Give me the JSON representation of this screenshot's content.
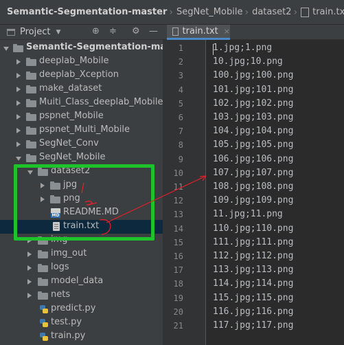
{
  "breadcrumb": {
    "root": "Semantic-Segmentation-master",
    "items": [
      "SegNet_Mobile",
      "dataset2"
    ],
    "file": "train.txt"
  },
  "project_panel": {
    "title": "Project",
    "toolbar_icons": [
      "target-icon",
      "collapse-icon",
      "gear-icon",
      "hide-icon"
    ]
  },
  "tabs": [
    {
      "label": "train.txt",
      "active": true,
      "close": "×"
    }
  ],
  "tree": [
    {
      "label": "Semantic-Segmentation-master",
      "type": "root",
      "expanded": true
    },
    {
      "label": "deeplab_Mobile",
      "type": "folder",
      "expanded": false
    },
    {
      "label": "deeplab_Xception",
      "type": "folder",
      "expanded": false
    },
    {
      "label": "make_dataset",
      "type": "folder",
      "expanded": false
    },
    {
      "label": "Muiti_Class_deeplab_Mobile",
      "type": "folder",
      "expanded": false
    },
    {
      "label": "pspnet_Mobile",
      "type": "folder",
      "expanded": false
    },
    {
      "label": "pspnet_Multi_Mobile",
      "type": "folder",
      "expanded": false
    },
    {
      "label": "SegNet_Conv",
      "type": "folder",
      "expanded": false
    },
    {
      "label": "SegNet_Mobile",
      "type": "folder",
      "expanded": true
    },
    {
      "label": "dataset2",
      "type": "folder",
      "expanded": true
    },
    {
      "label": "jpg",
      "type": "folder",
      "expanded": false
    },
    {
      "label": "png",
      "type": "folder",
      "expanded": false
    },
    {
      "label": "README.MD",
      "type": "md"
    },
    {
      "label": "train.txt",
      "type": "txt",
      "selected": true
    },
    {
      "label": "img",
      "type": "folder",
      "expanded": false
    },
    {
      "label": "img_out",
      "type": "folder",
      "expanded": false
    },
    {
      "label": "logs",
      "type": "folder",
      "expanded": false
    },
    {
      "label": "model_data",
      "type": "folder",
      "expanded": false
    },
    {
      "label": "nets",
      "type": "folder",
      "expanded": false
    },
    {
      "label": "predict.py",
      "type": "py"
    },
    {
      "label": "test.py",
      "type": "py"
    },
    {
      "label": "train.py",
      "type": "py"
    }
  ],
  "editor": {
    "line_numbers": [
      "1",
      "2",
      "3",
      "4",
      "5",
      "6",
      "7",
      "8",
      "9",
      "10",
      "11",
      "12",
      "13",
      "14",
      "15",
      "16",
      "17",
      "18",
      "19",
      "20",
      "21"
    ],
    "lines": [
      "1.jpg;1.png",
      "10.jpg;10.png",
      "100.jpg;100.png",
      "101.jpg;101.png",
      "102.jpg;102.png",
      "103.jpg;103.png",
      "104.jpg;104.png",
      "105.jpg;105.png",
      "106.jpg;106.png",
      "107.jpg;107.png",
      "108.jpg;108.png",
      "109.jpg;109.png",
      "11.jpg;11.png",
      "110.jpg;110.png",
      "111.jpg;111.png",
      "112.jpg;112.png",
      "113.jpg;113.png",
      "114.jpg;114.png",
      "115.jpg;115.png",
      "116.jpg;116.png",
      "117.jpg;117.png"
    ]
  },
  "colors": {
    "highlight_box": "#1ec32c",
    "annotation": "#e0202a",
    "selection": "#0d293e",
    "tab_underline": "#4a88c7"
  }
}
